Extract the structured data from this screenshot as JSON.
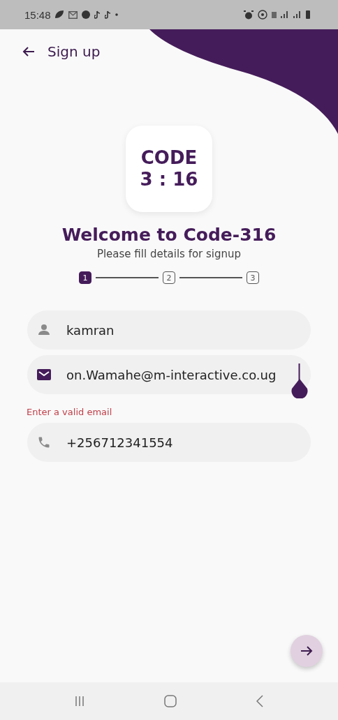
{
  "status_bar": {
    "time": "15:48"
  },
  "header": {
    "title": "Sign up"
  },
  "logo": {
    "line_1": "CODE",
    "line_2": "3 : 16"
  },
  "title": "Welcome to Code-316",
  "subtitle": "Please fill details for signup",
  "steps": [
    {
      "label": "1",
      "selected": true
    },
    {
      "label": "2",
      "selected": false
    },
    {
      "label": "3",
      "selected": false
    }
  ],
  "fields": [
    {
      "kind": "person",
      "value": "kamran",
      "focused": false
    },
    {
      "kind": "email",
      "value": "on.Wamahe@m-interactive.co.ug",
      "focused": true,
      "error": "Enter a valid email"
    },
    {
      "kind": "phone",
      "value": "+256712341554",
      "focused": false
    }
  ]
}
